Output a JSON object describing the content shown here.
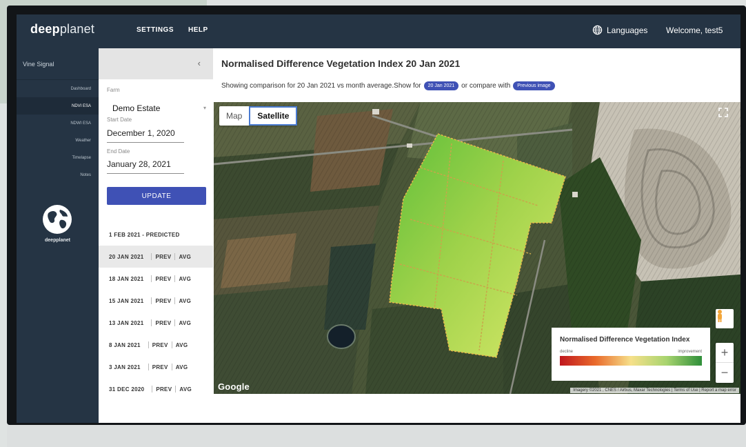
{
  "header": {
    "logo_bold": "deep",
    "logo_light": "planet",
    "nav": [
      "SETTINGS",
      "HELP"
    ],
    "languages_label": "Languages",
    "welcome": "Welcome, test5"
  },
  "sidebar": {
    "title": "Vine Signal",
    "items": [
      {
        "label": "Dashboard",
        "active": false
      },
      {
        "label": "NDVI ESA",
        "active": true
      },
      {
        "label": "NDWI ESA",
        "active": false
      },
      {
        "label": "Weather",
        "active": false
      },
      {
        "label": "Timelapse",
        "active": false
      },
      {
        "label": "Notes",
        "active": false
      }
    ],
    "logo_text": "deepplanet"
  },
  "panel": {
    "collapse_icon": "chevron-left-icon",
    "farm_label": "Farm",
    "farm_value": "Demo Estate",
    "start_label": "Start Date",
    "start_value": "December 1, 2020",
    "end_label": "End Date",
    "end_value": "January 28, 2021",
    "update_label": "UPDATE",
    "predicted_label": "1 FEB 2021 - PREDICTED",
    "dates": [
      {
        "date": "20 JAN 2021",
        "prev": "PREV",
        "avg": "AVG",
        "selected": true
      },
      {
        "date": "18 JAN 2021",
        "prev": "PREV",
        "avg": "AVG",
        "selected": false
      },
      {
        "date": "15 JAN 2021",
        "prev": "PREV",
        "avg": "AVG",
        "selected": false
      },
      {
        "date": "13 JAN 2021",
        "prev": "PREV",
        "avg": "AVG",
        "selected": false
      },
      {
        "date": "8 JAN 2021",
        "prev": "PREV",
        "avg": "AVG",
        "selected": false
      },
      {
        "date": "3 JAN 2021",
        "prev": "PREV",
        "avg": "AVG",
        "selected": false
      },
      {
        "date": "31 DEC 2020",
        "prev": "PREV",
        "avg": "AVG",
        "selected": false
      }
    ]
  },
  "main": {
    "title": "Normalised Difference Vegetation Index 20 Jan 2021",
    "subtitle_prefix": "Showing comparison for 20 Jan 2021 vs month average.Show for",
    "pill_date": "20 Jan 2021",
    "subtitle_mid": "or compare with",
    "pill_previous": "Previous image"
  },
  "map": {
    "type_map": "Map",
    "type_satellite": "Satellite",
    "selected_type": "Satellite",
    "legend_title": "Normalised Difference Vegetation Index",
    "legend_low": "decline",
    "legend_high": "improvement",
    "google_label": "Google",
    "attribution": "Imagery ©2021 , CNES / Airbus, Maxar Technologies | Terms of Use | Report a map error",
    "zoom_in": "+",
    "zoom_out": "−"
  },
  "colors": {
    "header_bg": "#253444",
    "accent": "#3f51b5",
    "legend_low": "#c0171e",
    "legend_high": "#2f8f3a"
  }
}
